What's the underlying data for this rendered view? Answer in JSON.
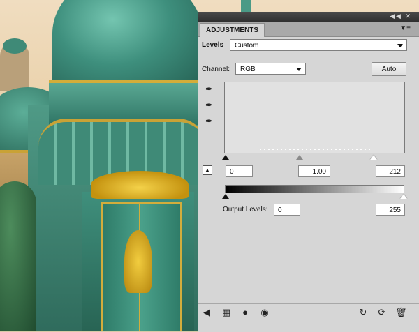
{
  "panel": {
    "tab_label": "ADJUSTMENTS",
    "menu_icon": "panel-menu-icon",
    "titlebar_icons": [
      "collapse-icon",
      "close-icon"
    ]
  },
  "levels": {
    "title": "Levels",
    "preset_value": "Custom",
    "channel_label": "Channel:",
    "channel_value": "RGB",
    "auto_label": "Auto",
    "input_black": "0",
    "input_gamma": "1.00",
    "input_white": "212",
    "output_label": "Output Levels:",
    "output_black": "0",
    "output_white": "255"
  },
  "icons": {
    "eyedroppers": [
      "black-eyedropper-icon",
      "gray-eyedropper-icon",
      "white-eyedropper-icon"
    ],
    "bottom_left": [
      "back-arrow-icon",
      "expand-view-icon",
      "clip-layer-icon",
      "visibility-eye-icon"
    ],
    "bottom_right": [
      "view-previous-icon",
      "reset-icon",
      "trash-icon"
    ]
  },
  "colors": {
    "panel_bg": "#d6d6d6",
    "titlebar": "#3a3a3a"
  }
}
